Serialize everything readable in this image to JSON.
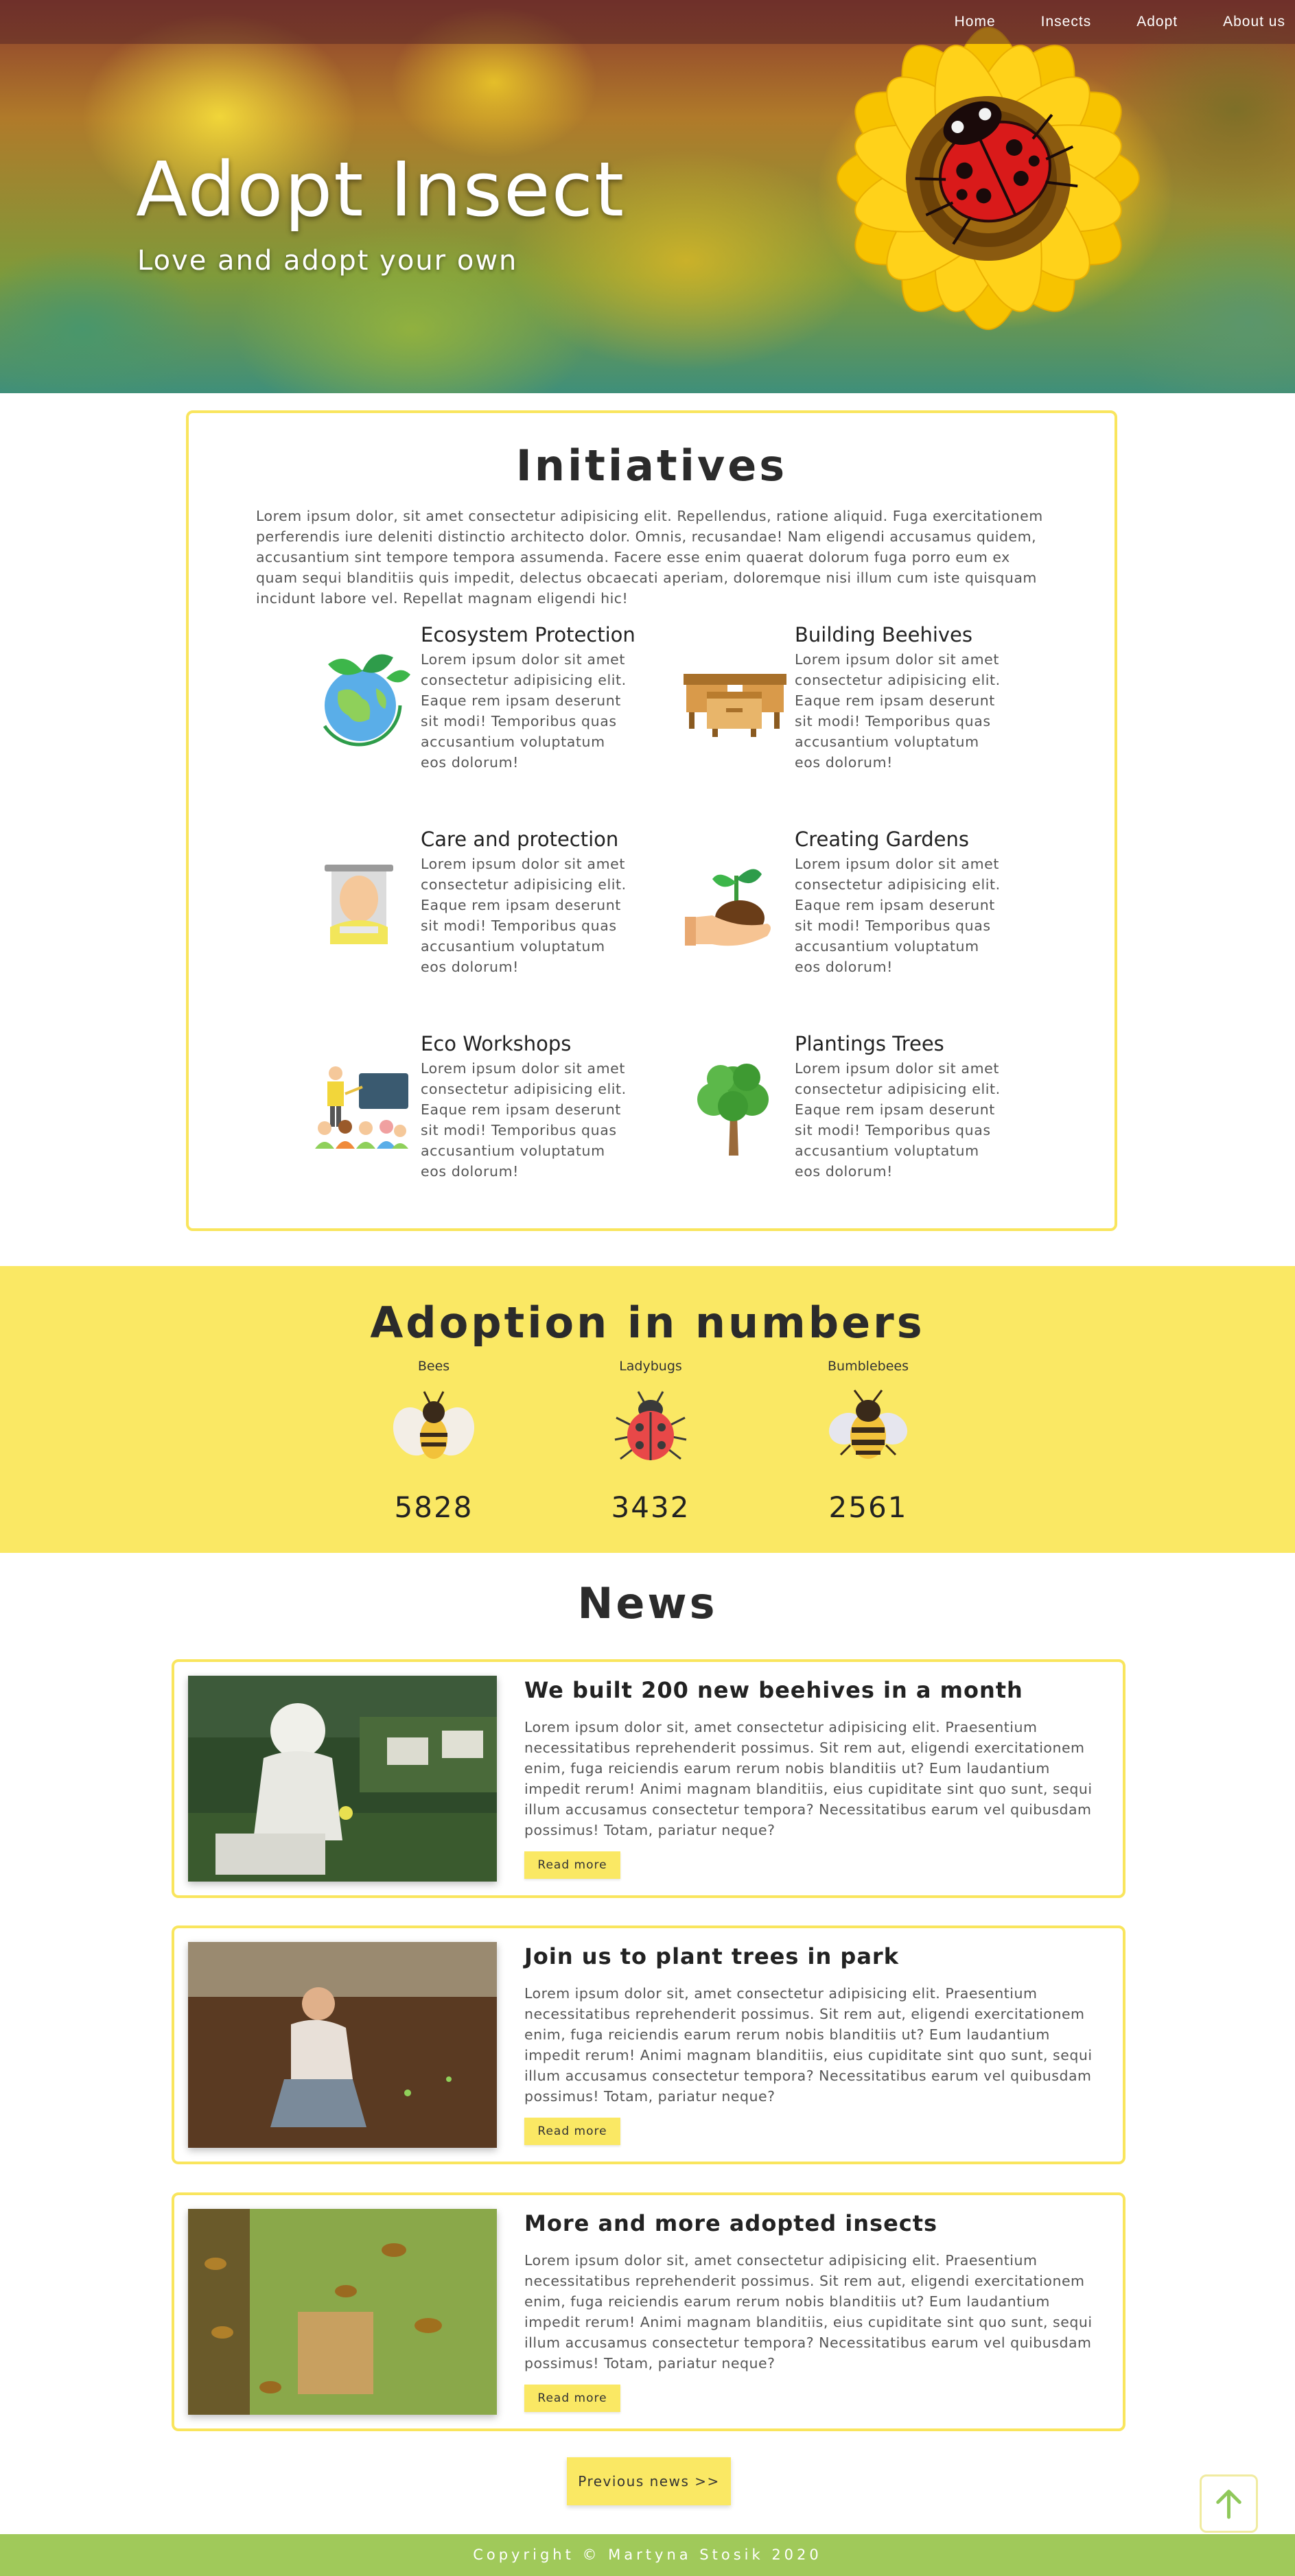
{
  "nav": {
    "links": [
      "Home",
      "Insects",
      "Adopt",
      "About us"
    ]
  },
  "hero": {
    "title": "Adopt Insect",
    "subtitle": "Love and adopt your own"
  },
  "initiatives": {
    "title": "Initiatives",
    "intro": "Lorem ipsum dolor, sit amet consectetur adipisicing elit. Repellendus, ratione aliquid. Fuga exercitationem perferendis iure deleniti distinctio architecto dolor. Omnis, recusandae! Nam eligendi accusamus quidem, accusantium sint tempore tempora assumenda. Facere esse enim quaerat dolorum fuga porro eum ex quam sequi blanditiis quis impedit, delectus obcaecati aperiam, doloremque nisi illum cum iste quisquam incidunt labore vel. Repellat magnam eligendi hic!",
    "items": [
      {
        "title": "Ecosystem Protection",
        "icon": "earth-with-leaves-icon",
        "text": "Lorem ipsum dolor sit amet consectetur adipisicing elit. Eaque rem ipsam deserunt sit modi! Temporibus quas accusantium voluptatum eos dolorum!"
      },
      {
        "title": "Building Beehives",
        "icon": "beehive-icon",
        "text": "Lorem ipsum dolor sit amet consectetur adipisicing elit. Eaque rem ipsam deserunt sit modi! Temporibus quas accusantium voluptatum eos dolorum!"
      },
      {
        "title": "Care and protection",
        "icon": "beekeeper-icon",
        "text": "Lorem ipsum dolor sit amet consectetur adipisicing elit. Eaque rem ipsam deserunt sit modi! Temporibus quas accusantium voluptatum eos dolorum!"
      },
      {
        "title": "Creating Gardens",
        "icon": "hand-with-sprout-icon",
        "text": "Lorem ipsum dolor sit amet consectetur adipisicing elit. Eaque rem ipsam deserunt sit modi! Temporibus quas accusantium voluptatum eos dolorum!"
      },
      {
        "title": "Eco Workshops",
        "icon": "workshop-presentation-icon",
        "text": "Lorem ipsum dolor sit amet consectetur adipisicing elit. Eaque rem ipsam deserunt sit modi! Temporibus quas accusantium voluptatum eos dolorum!"
      },
      {
        "title": "Plantings Trees",
        "icon": "tree-icon",
        "text": "Lorem ipsum dolor sit amet consectetur adipisicing elit. Eaque rem ipsam deserunt sit modi! Temporibus quas accusantium voluptatum eos dolorum!"
      }
    ]
  },
  "numbers": {
    "title": "Adoption in numbers",
    "items": [
      {
        "label": "Bees",
        "value": "5828",
        "icon": "bee-icon"
      },
      {
        "label": "Ladybugs",
        "value": "3432",
        "icon": "ladybug-icon"
      },
      {
        "label": "Bumblebees",
        "value": "2561",
        "icon": "bumblebee-icon"
      }
    ]
  },
  "news": {
    "title": "News",
    "read_more_label": "Read more",
    "items": [
      {
        "heading": "We built 200 new beehives in a month",
        "text": "Lorem ipsum dolor sit, amet consectetur adipisicing elit. Praesentium necessitatibus reprehenderit possimus. Sit rem aut, eligendi exercitationem enim, fuga reiciendis earum rerum nobis blanditiis ut? Eum laudantium impedit rerum! Animi magnam blanditiis, eius cupiditate sint quo sunt, sequi illum accusamus consectetur tempora? Necessitatibus earum vel quibusdam possimus! Totam, pariatur neque?"
      },
      {
        "heading": "Join us to plant trees in park",
        "text": "Lorem ipsum dolor sit, amet consectetur adipisicing elit. Praesentium necessitatibus reprehenderit possimus. Sit rem aut, eligendi exercitationem enim, fuga reiciendis earum rerum nobis blanditiis ut? Eum laudantium impedit rerum! Animi magnam blanditiis, eius cupiditate sint quo sunt, sequi illum accusamus consectetur tempora? Necessitatibus earum vel quibusdam possimus! Totam, pariatur neque?"
      },
      {
        "heading": "More and more adopted insects",
        "text": "Lorem ipsum dolor sit, amet consectetur adipisicing elit. Praesentium necessitatibus reprehenderit possimus. Sit rem aut, eligendi exercitationem enim, fuga reiciendis earum rerum nobis blanditiis ut? Eum laudantium impedit rerum! Animi magnam blanditiis, eius cupiditate sint quo sunt, sequi illum accusamus consectetur tempora? Necessitatibus earum vel quibusdam possimus! Totam, pariatur neque?"
      }
    ],
    "previous_label": "Previous news >>"
  },
  "back_to_top_icon": "arrow-up-icon",
  "footer": {
    "text": "Copyright © Martyna Stosik 2020"
  },
  "colors": {
    "accent_yellow": "#fae864",
    "card_border": "#f9e55d",
    "footer_green": "#a0c95a"
  }
}
